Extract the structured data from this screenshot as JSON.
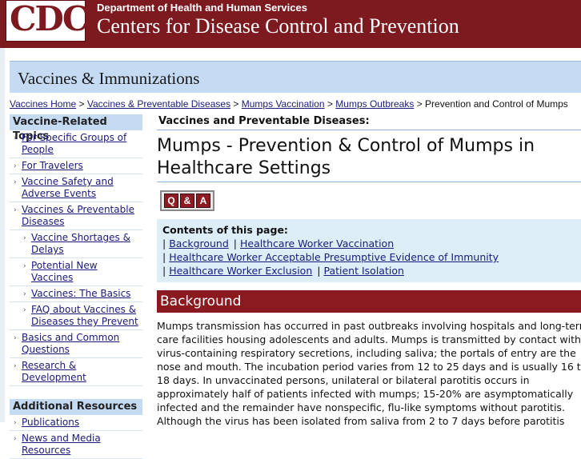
{
  "header": {
    "logo_text": "CDC",
    "department": "Department of Health and Human Services",
    "agency": "Centers for Disease Control and Prevention"
  },
  "banner": {
    "title": "Vaccines & Immunizations"
  },
  "breadcrumb": {
    "links": [
      "Vaccines Home",
      "Vaccines & Preventable Diseases",
      "Mumps Vaccination",
      "Mumps Outbreaks"
    ],
    "separator": ">",
    "current": "Prevention and Control of Mumps"
  },
  "left_nav": {
    "heading": "Vaccine-Related Topics",
    "items": [
      {
        "label": "For Specific Groups of People",
        "sub": false
      },
      {
        "label": "For Travelers",
        "sub": false
      },
      {
        "label": "Vaccine Safety and Adverse Events",
        "sub": false
      },
      {
        "label": "Vaccines & Preventable Diseases",
        "sub": false
      },
      {
        "label": "Vaccine Shortages & Delays",
        "sub": true
      },
      {
        "label": "Potential New Vaccines",
        "sub": true
      },
      {
        "label": "Vaccines: The Basics",
        "sub": true
      },
      {
        "label": "FAQ about Vaccines & Diseases they Prevent",
        "sub": true
      },
      {
        "label": "Basics and Common Questions",
        "sub": false
      },
      {
        "label": "Research & Development",
        "sub": false
      }
    ],
    "heading2": "Additional Resources",
    "items2": [
      {
        "label": "Publications"
      },
      {
        "label": "News and Media Resources"
      }
    ]
  },
  "main": {
    "kicker": "Vaccines and Preventable Diseases:",
    "title": "Mumps - Prevention & Control of Mumps in Healthcare Settings",
    "qa_badge": [
      "Q",
      "&",
      "A"
    ],
    "toc": {
      "heading": "Contents of this page:",
      "rows": [
        [
          "Background",
          "Healthcare Worker Vaccination"
        ],
        [
          "Healthcare Worker Acceptable Presumptive Evidence of Immunity"
        ],
        [
          "Healthcare Worker Exclusion",
          "Patient Isolation"
        ]
      ]
    },
    "section_heading": "Background",
    "body": "Mumps transmission has occurred in past outbreaks involving hospitals and long-term care facilities housing adolescents and adults. Mumps is transmitted by contact with virus-containing respiratory secretions, including saliva; the portals of entry are the nose and mouth. The incubation period varies from 12 to 25 days and is usually 16 to 18 days. In unvaccinated persons, unilateral or bilateral parotitis occurs in approximately half of patients infected with mumps; 15-20% are asymptomatically infected and the remainder have nonspecific, flu-like symptoms without parotitis. Although the virus has been isolated from saliva from 2 to 7 days before parotitis"
  },
  "colors": {
    "header_bg": "#7d1a1f",
    "banner_bg": "#c4dbf3",
    "section_bg": "#8b1a20",
    "toc_bg": "#ddeef9",
    "link": "#1a1a7a"
  }
}
